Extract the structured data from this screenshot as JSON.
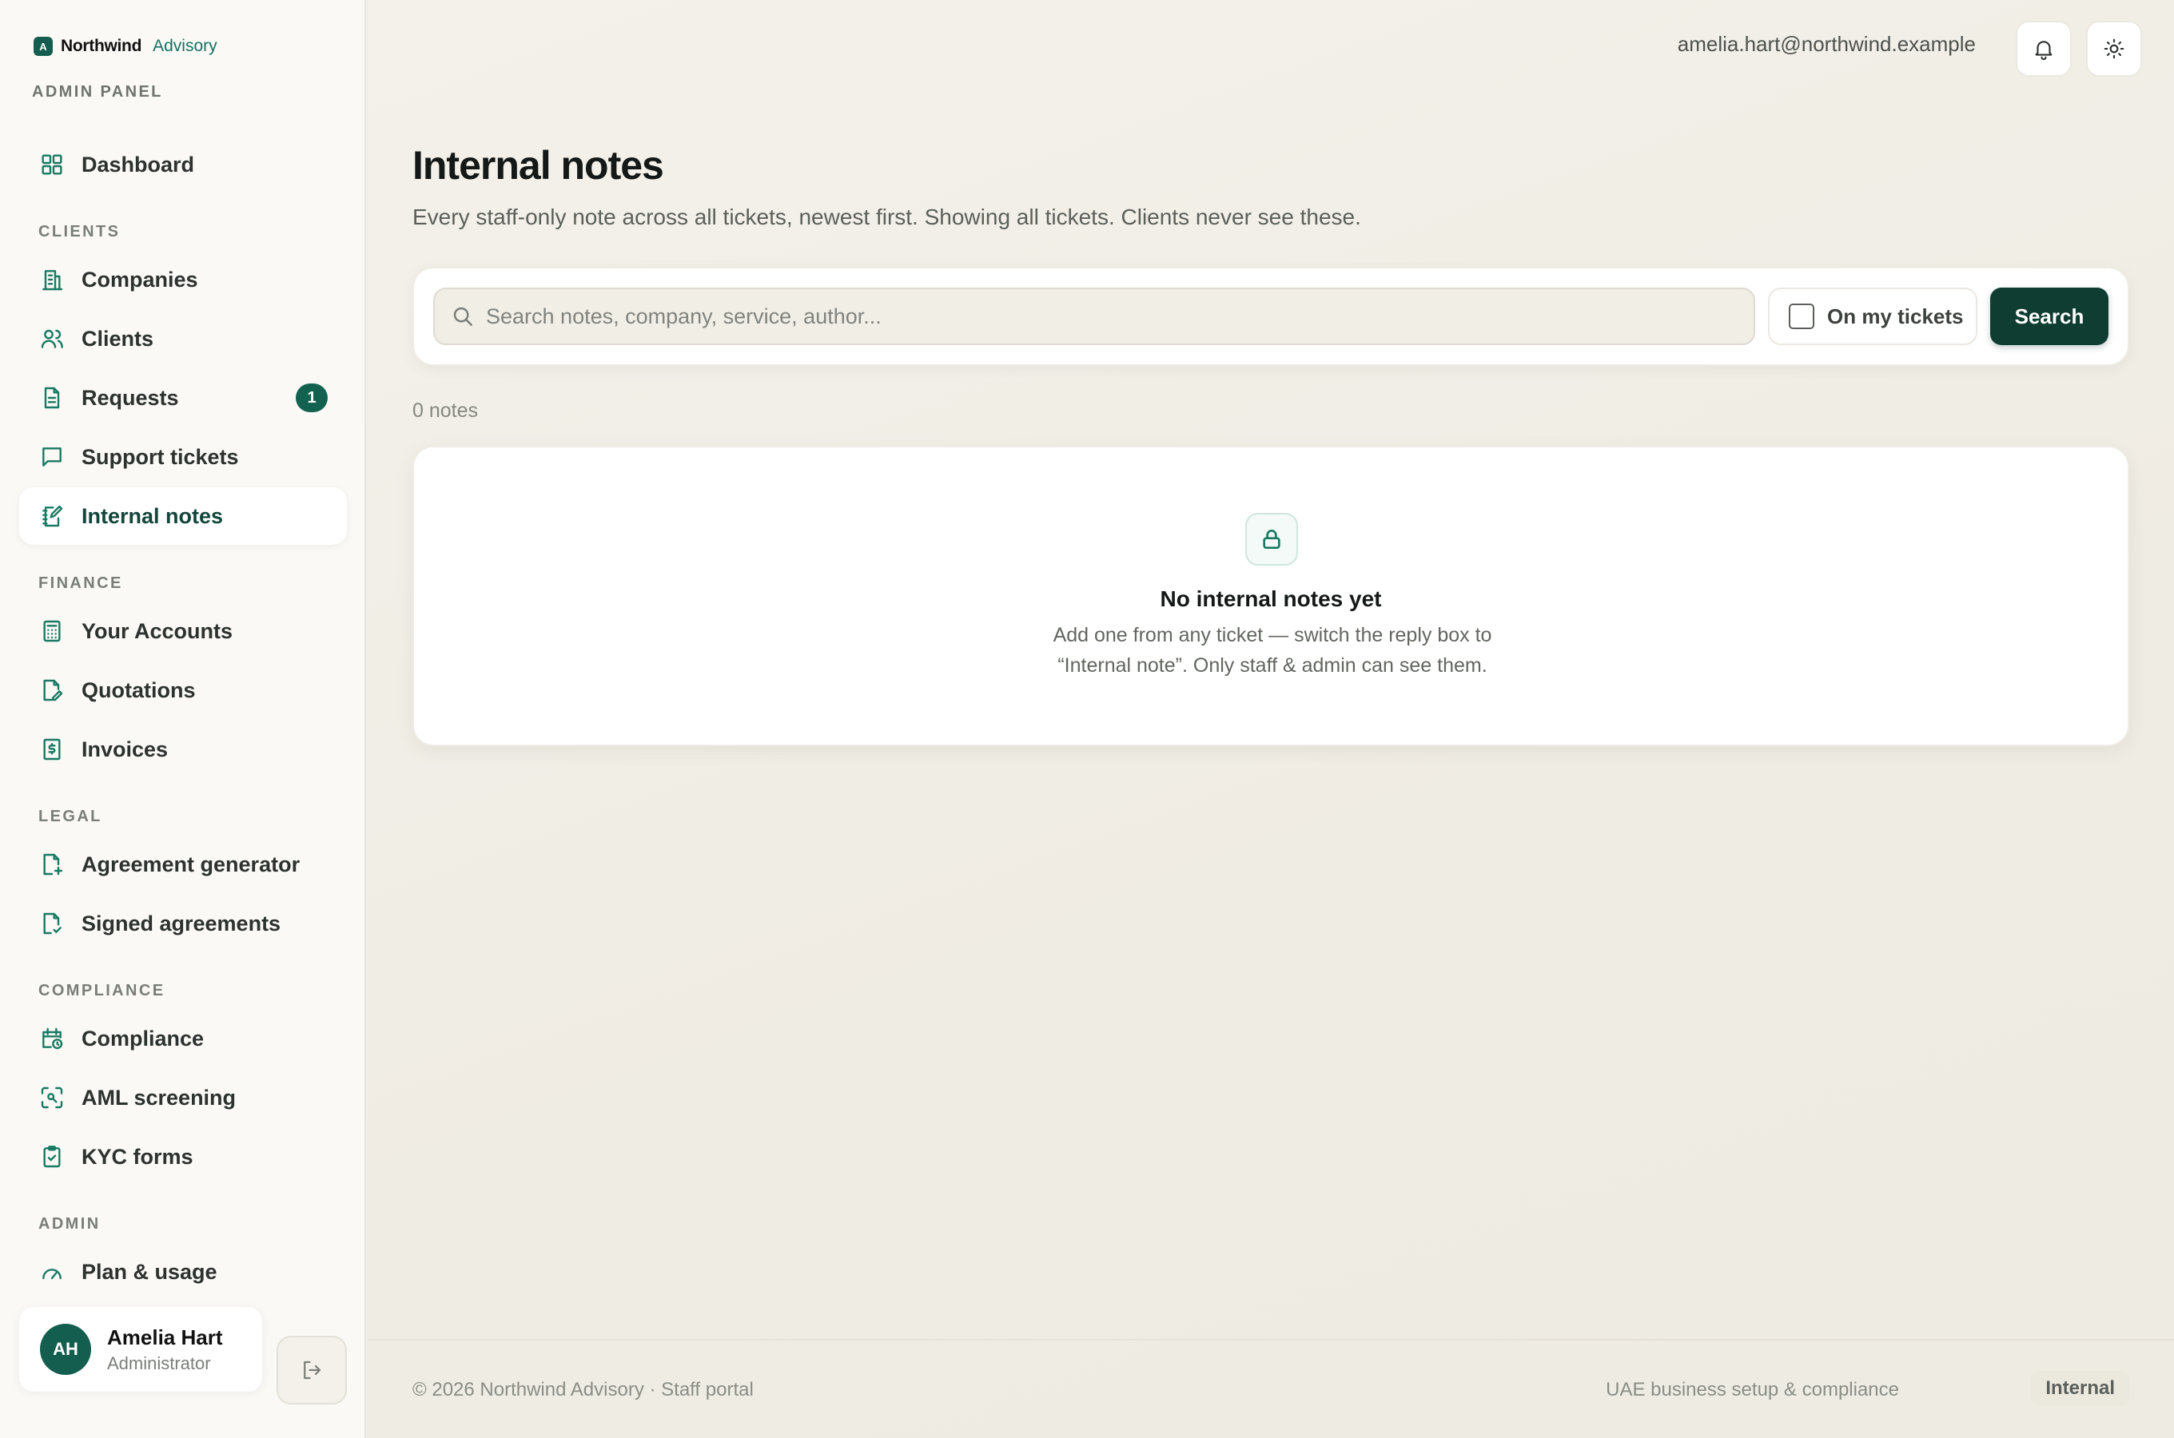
{
  "brand": {
    "logo_letter": "A",
    "name": "Northwind",
    "sub": "Advisory",
    "panel_label": "ADMIN PANEL"
  },
  "sidebar": {
    "dashboard": "Dashboard",
    "sections": {
      "clients": "CLIENTS",
      "finance": "FINANCE",
      "legal": "LEGAL",
      "compliance": "COMPLIANCE",
      "admin": "ADMIN"
    },
    "items": {
      "companies": "Companies",
      "clients": "Clients",
      "requests": "Requests",
      "requests_badge": "1",
      "support_tickets": "Support tickets",
      "internal_notes": "Internal notes",
      "your_accounts": "Your Accounts",
      "quotations": "Quotations",
      "invoices": "Invoices",
      "agreement_generator": "Agreement generator",
      "signed_agreements": "Signed agreements",
      "compliance": "Compliance",
      "aml_screening": "AML screening",
      "kyc_forms": "KYC forms",
      "plan_usage": "Plan & usage"
    },
    "user": {
      "initials": "AH",
      "name": "Amelia Hart",
      "role": "Administrator"
    }
  },
  "header": {
    "email": "amelia.hart@northwind.example"
  },
  "main": {
    "title": "Internal notes",
    "subtitle": "Every staff-only note across all tickets, newest first. Showing all tickets. Clients never see these.",
    "search_placeholder": "Search notes, company, service, author...",
    "mine_label": "On my tickets",
    "mine_checked": false,
    "search_button": "Search",
    "count": "0 notes",
    "empty_title": "No internal notes yet",
    "empty_text": "Add one from any ticket — switch the reply box to “Internal note”. Only staff & admin can see them."
  },
  "footer": {
    "left": "© 2026 Northwind Advisory · Staff portal",
    "right": "UAE business setup & compliance",
    "pill": "Internal"
  },
  "colors": {
    "accent": "#187a62",
    "primary_button": "#0f3d32",
    "badge": "#13624f"
  }
}
